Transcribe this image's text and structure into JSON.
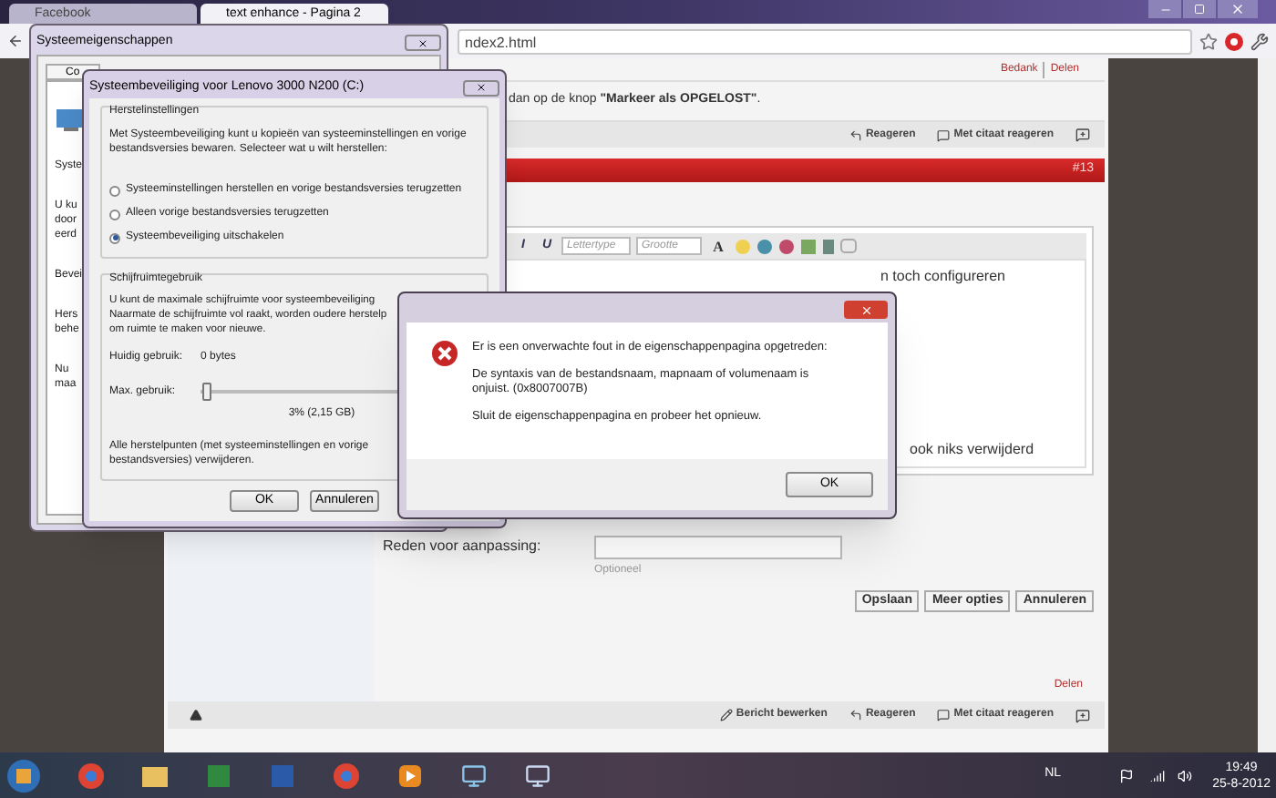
{
  "browser": {
    "tabs": [
      {
        "label": "Facebook",
        "selected": false
      },
      {
        "label": "text enhance - Pagina 2",
        "selected": true
      }
    ],
    "address": "ndex2.html"
  },
  "page": {
    "post_links": [
      "Bedank",
      "Delen"
    ],
    "instruction": "dan op de knop **\"Markeer als OPGELOST\"**.",
    "actions": [
      "Reageren",
      "Met citaat reageren"
    ],
    "post_number": "#13",
    "editor": {
      "format_buttons": [
        "I",
        "U"
      ],
      "font_select": "Lettertype",
      "size_select": "Grootte",
      "color_button": "A",
      "text_lines": [
        "n toch configureren",
        "ook niks verwijderd"
      ]
    },
    "reason_label": "Reden voor aanpassing:",
    "reason_help": "Optioneel",
    "buttons": [
      "Opslaan",
      "Meer opties",
      "Annuleren"
    ],
    "footer_link": "Delen",
    "bottom_actions": [
      "Bericht bewerken",
      "Reageren",
      "Met citaat reageren"
    ]
  },
  "system_properties": {
    "title": "Systeemeigenschappen",
    "tab": "Co",
    "fragments": [
      [
        "Syste"
      ],
      [
        "U ku",
        "door",
        "eerd"
      ],
      [
        "Bevei"
      ],
      [
        "Hers",
        "behe"
      ],
      [
        "Nu",
        "maa"
      ]
    ]
  },
  "protection": {
    "title": "Systeembeveiliging voor Lenovo 3000 N200 (C:)",
    "restore_group": "Herstelinstellingen",
    "restore_text": "Met Systeembeveiliging kunt u kopieën van systeeminstellingen en vorige bestandsversies bewaren. Selecteer wat u wilt herstellen:",
    "options": [
      {
        "label": "Systeeminstellingen herstellen en vorige bestandsversies terugzetten",
        "selected": false
      },
      {
        "label": "Alleen vorige bestandsversies terugzetten",
        "selected": false
      },
      {
        "label": "Systeembeveiliging uitschakelen",
        "selected": true
      }
    ],
    "disk_group": "Schijfruimtegebruik",
    "disk_text": [
      "U kunt de maximale schijfruimte voor systeembeveiliging",
      "Naarmate de schijfruimte vol raakt, worden oudere herstelp",
      "om ruimte te maken voor nieuwe."
    ],
    "current_label": "Huidig gebruik:",
    "current_value": "0 bytes",
    "max_label": "Max. gebruik:",
    "max_usage": {
      "level": 0.03
    },
    "max_reading": "3% (2,15 GB)",
    "delete_text": "Alle herstelpunten (met systeeminstellingen en vorige bestandsversies) verwijderen.",
    "buttons": [
      "OK",
      "Annuleren"
    ]
  },
  "error": {
    "messages": [
      "Er is een onverwachte fout in de eigenschappenpagina opgetreden:",
      "De syntaxis van de bestandsnaam, mapnaam of volumenaam is onjuist. (0x8007007B)",
      "Sluit de eigenschappenpagina en probeer het opnieuw."
    ],
    "button": "OK"
  },
  "taskbar": {
    "language": "NL",
    "time": "19:49",
    "date": "25-8-2012"
  }
}
